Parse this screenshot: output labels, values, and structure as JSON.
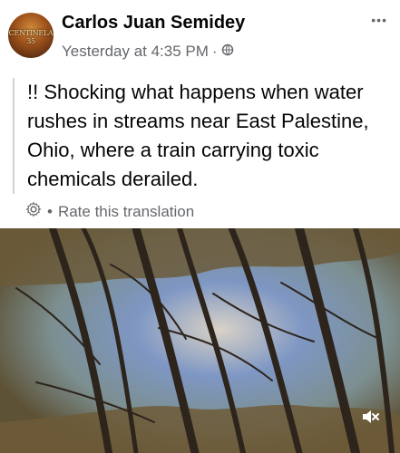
{
  "post": {
    "author": "Carlos Juan Semidey",
    "timestamp": "Yesterday at 4:35 PM",
    "separator": "·",
    "text": "!!  Shocking what happens when water rushes in streams near East Palestine, Ohio, where a train carrying toxic chemicals derailed.",
    "translation_link": "Rate this translation",
    "translation_separator": "•",
    "avatar_text": "CENTINELA 35"
  },
  "icons": {
    "more": "more-options-icon",
    "privacy": "globe-icon",
    "settings": "gear-icon",
    "mute": "muted-speaker-icon"
  }
}
